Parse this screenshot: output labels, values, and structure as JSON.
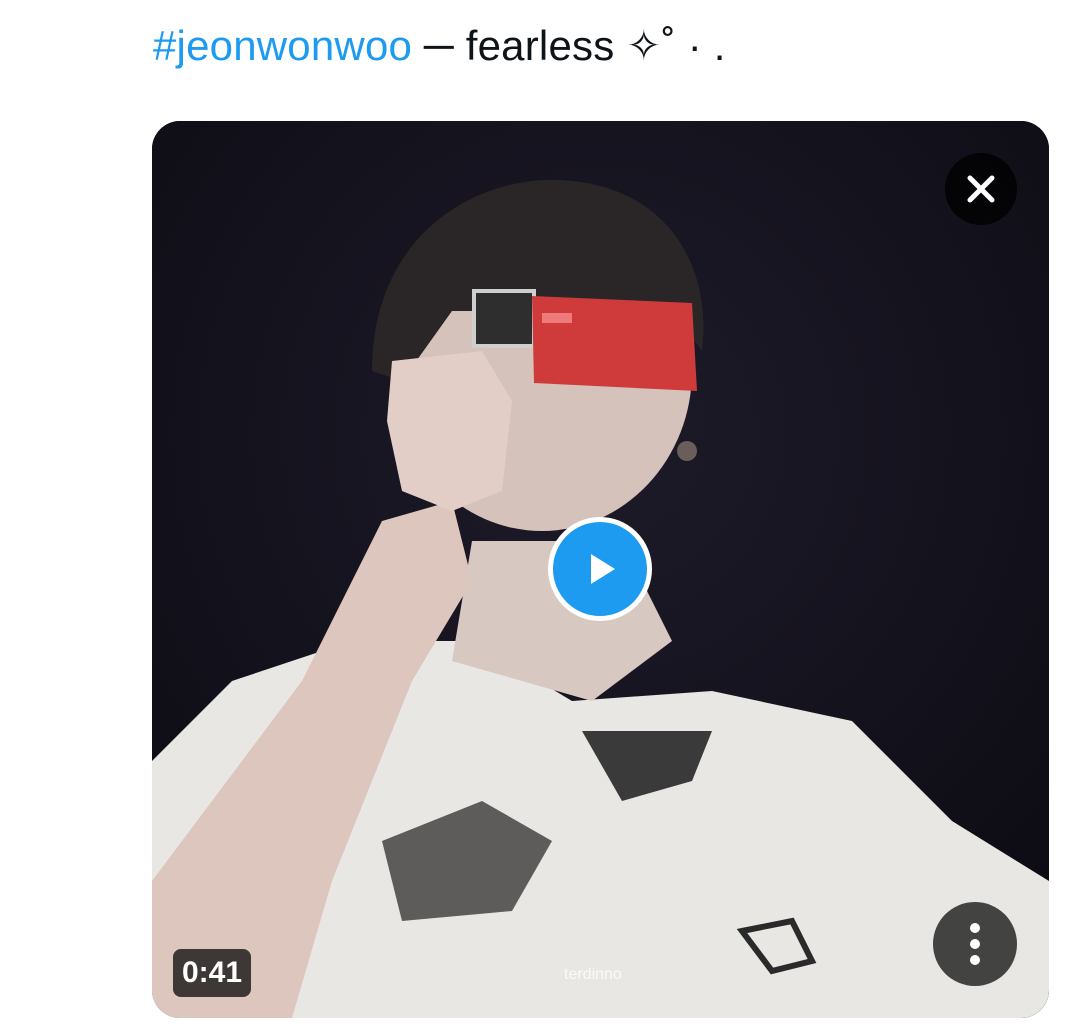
{
  "tweet": {
    "hashtag": "#jeonwonwoo",
    "text_rest": " ─ fearless ✧˚ · ."
  },
  "video": {
    "duration": "0:41",
    "watermark": "terdinno",
    "close_icon": "close-icon",
    "play_icon": "play-icon",
    "more_icon": "more-vertical-icon",
    "accent_color": "#1d9bf0"
  }
}
